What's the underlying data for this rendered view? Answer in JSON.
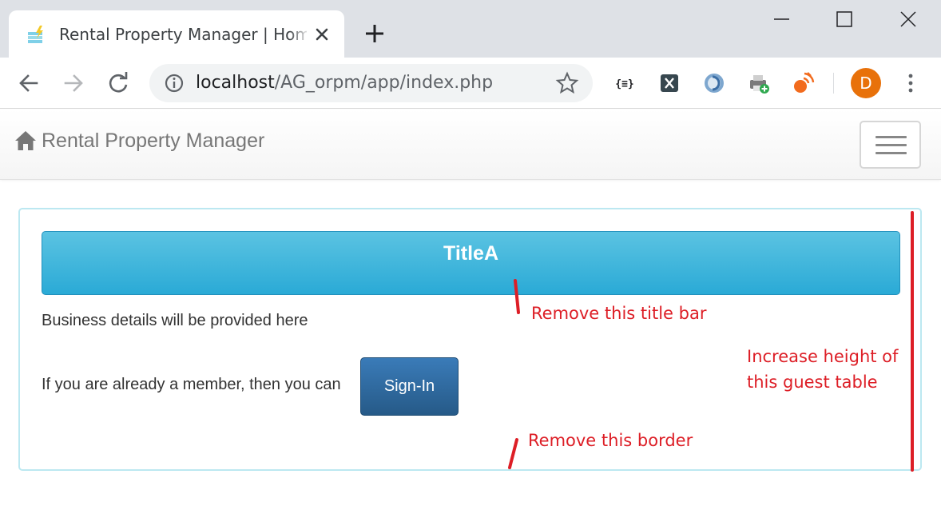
{
  "browser": {
    "tab_title": "Rental Property Manager | Home",
    "url_host": "localhost",
    "url_path": "/AG_orpm/app/index.php",
    "avatar_letter": "D",
    "extensions": [
      "json-viewer-icon",
      "x-extension-icon",
      "cloud-sync-icon",
      "printer-plus-icon",
      "satellite-icon"
    ]
  },
  "navbar": {
    "brand": "Rental Property Manager",
    "brand_icon": "home-icon"
  },
  "panel": {
    "title": "TitleA",
    "business_text": "Business details will be provided here",
    "member_text": "If you are already a member, then you can",
    "signin_label": "Sign-In"
  },
  "annotations": {
    "title_bar": "Remove this title bar",
    "border": "Remove this border",
    "height_line1": "Increase height of",
    "height_line2": "this guest table"
  },
  "colors": {
    "annotation_red": "#dd1e26",
    "title_bar": "#2aaad6",
    "signin_button": "#265a88",
    "panel_border": "#bce8f1",
    "avatar": "#e8710a"
  }
}
